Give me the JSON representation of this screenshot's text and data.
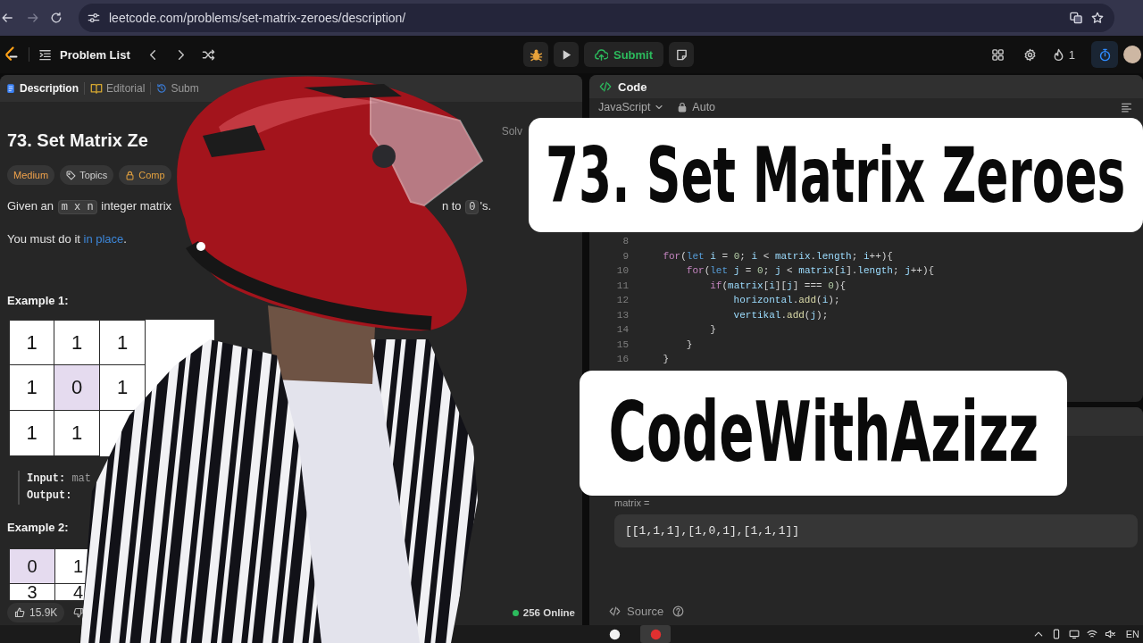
{
  "browser": {
    "url": "leetcode.com/problems/set-matrix-zeroes/description/"
  },
  "nav": {
    "problem_list": "Problem List",
    "submit": "Submit",
    "streak": "1"
  },
  "description": {
    "tabs": [
      {
        "label": "Description",
        "kind": "description",
        "selected": true
      },
      {
        "label": "Editorial",
        "kind": "editorial",
        "selected": false
      },
      {
        "label": "Subm",
        "kind": "submissions",
        "selected": false
      }
    ],
    "status": "Solv",
    "title": "73. Set Matrix Ze",
    "tags": [
      {
        "label": "Medium",
        "kind": "difficulty"
      },
      {
        "label": "Topics",
        "kind": "topics"
      },
      {
        "label": "Comp",
        "kind": "companies"
      }
    ],
    "statement": [
      {
        "fragments": [
          [
            {
              "text": "Given an ",
              "kind": "plain"
            },
            {
              "text": "m x n",
              "kind": "code"
            },
            {
              "text": " integer matrix",
              "kind": "plain"
            }
          ],
          [
            {
              "text": "n to ",
              "kind": "plain"
            },
            {
              "text": "0",
              "kind": "code"
            },
            {
              "text": "'s.",
              "kind": "plain"
            }
          ]
        ]
      },
      {
        "fragments": [
          [
            {
              "text": "You must do it ",
              "kind": "plain"
            },
            {
              "text": "in place",
              "kind": "link"
            },
            {
              "text": ".",
              "kind": "plain"
            }
          ]
        ]
      }
    ],
    "examples": [
      {
        "heading": "Example 1:",
        "matrix": [
          [
            {
              "value": "1",
              "highlighted": false
            },
            {
              "value": "1",
              "highlighted": false
            },
            {
              "value": "1",
              "highlighted": false
            }
          ],
          [
            {
              "value": "1",
              "highlighted": false
            },
            {
              "value": "0",
              "highlighted": true
            },
            {
              "value": "1",
              "highlighted": false
            }
          ],
          [
            {
              "value": "1",
              "highlighted": false
            },
            {
              "value": "1",
              "highlighted": false
            }
          ]
        ],
        "io": [
          {
            "label": "Input:",
            "value": "mat"
          },
          {
            "label": "Output:"
          }
        ]
      },
      {
        "heading": "Example 2:",
        "matrix": [
          [
            {
              "value": "0",
              "highlighted": true
            },
            {
              "value": "1",
              "highlighted": false
            }
          ],
          [
            {
              "value": "3",
              "highlighted": false
            },
            {
              "value": "4",
              "highlighted": false
            }
          ]
        ]
      }
    ],
    "likes": "15.9K",
    "online": "256 Online"
  },
  "code": {
    "title": "Code",
    "language": "JavaScript",
    "mode": "Auto",
    "lines": [
      {
        "number": "8"
      },
      {
        "number": "9",
        "tokens": [
          {
            "text": "    for",
            "kind": "keyword"
          },
          {
            "text": "(",
            "kind": "punct"
          },
          {
            "text": "let",
            "kind": "decl"
          },
          {
            "text": " i",
            "kind": "var"
          },
          {
            "text": " = ",
            "kind": "punct"
          },
          {
            "text": "0",
            "kind": "num"
          },
          {
            "text": "; ",
            "kind": "punct"
          },
          {
            "text": "i",
            "kind": "var"
          },
          {
            "text": " < ",
            "kind": "punct"
          },
          {
            "text": "matrix",
            "kind": "var"
          },
          {
            "text": ".",
            "kind": "punct"
          },
          {
            "text": "length",
            "kind": "var"
          },
          {
            "text": "; ",
            "kind": "punct"
          },
          {
            "text": "i",
            "kind": "var"
          },
          {
            "text": "++){",
            "kind": "punct"
          }
        ]
      },
      {
        "number": "10",
        "tokens": [
          {
            "text": "        for",
            "kind": "keyword"
          },
          {
            "text": "(",
            "kind": "punct"
          },
          {
            "text": "let",
            "kind": "decl"
          },
          {
            "text": " j",
            "kind": "var"
          },
          {
            "text": " = ",
            "kind": "punct"
          },
          {
            "text": "0",
            "kind": "num"
          },
          {
            "text": "; ",
            "kind": "punct"
          },
          {
            "text": "j",
            "kind": "var"
          },
          {
            "text": " < ",
            "kind": "punct"
          },
          {
            "text": "matrix",
            "kind": "var"
          },
          {
            "text": "[",
            "kind": "punct"
          },
          {
            "text": "i",
            "kind": "var"
          },
          {
            "text": "].",
            "kind": "punct"
          },
          {
            "text": "length",
            "kind": "var"
          },
          {
            "text": "; ",
            "kind": "punct"
          },
          {
            "text": "j",
            "kind": "var"
          },
          {
            "text": "++){",
            "kind": "punct"
          }
        ]
      },
      {
        "number": "11",
        "tokens": [
          {
            "text": "            if",
            "kind": "keyword"
          },
          {
            "text": "(",
            "kind": "punct"
          },
          {
            "text": "matrix",
            "kind": "var"
          },
          {
            "text": "[",
            "kind": "punct"
          },
          {
            "text": "i",
            "kind": "var"
          },
          {
            "text": "][",
            "kind": "punct"
          },
          {
            "text": "j",
            "kind": "var"
          },
          {
            "text": "] === ",
            "kind": "punct"
          },
          {
            "text": "0",
            "kind": "num"
          },
          {
            "text": "){",
            "kind": "punct"
          }
        ]
      },
      {
        "number": "12",
        "tokens": [
          {
            "text": "                horizontal",
            "kind": "var"
          },
          {
            "text": ".",
            "kind": "punct"
          },
          {
            "text": "add",
            "kind": "fn"
          },
          {
            "text": "(",
            "kind": "punct"
          },
          {
            "text": "i",
            "kind": "var"
          },
          {
            "text": ");",
            "kind": "punct"
          }
        ]
      },
      {
        "number": "13",
        "tokens": [
          {
            "text": "                vertikal",
            "kind": "var"
          },
          {
            "text": ".",
            "kind": "punct"
          },
          {
            "text": "add",
            "kind": "fn"
          },
          {
            "text": "(",
            "kind": "punct"
          },
          {
            "text": "j",
            "kind": "var"
          },
          {
            "text": ");",
            "kind": "punct"
          }
        ]
      },
      {
        "number": "14",
        "tokens": [
          {
            "text": "            }",
            "kind": "punct"
          }
        ]
      },
      {
        "number": "15",
        "tokens": [
          {
            "text": "        }",
            "kind": "punct"
          }
        ]
      },
      {
        "number": "16",
        "tokens": [
          {
            "text": "    }",
            "kind": "punct"
          }
        ]
      }
    ]
  },
  "testcase": {
    "label": "matrix =",
    "value": "[[1,1,1],[1,0,1],[1,1,1]]",
    "source": "Source"
  },
  "banners": [
    {
      "text": "73. Set Matrix Zeroes",
      "kind": "title"
    },
    {
      "text": "CodeWithAzizz",
      "kind": "channel"
    }
  ],
  "taskbar": {
    "language": "EN"
  }
}
